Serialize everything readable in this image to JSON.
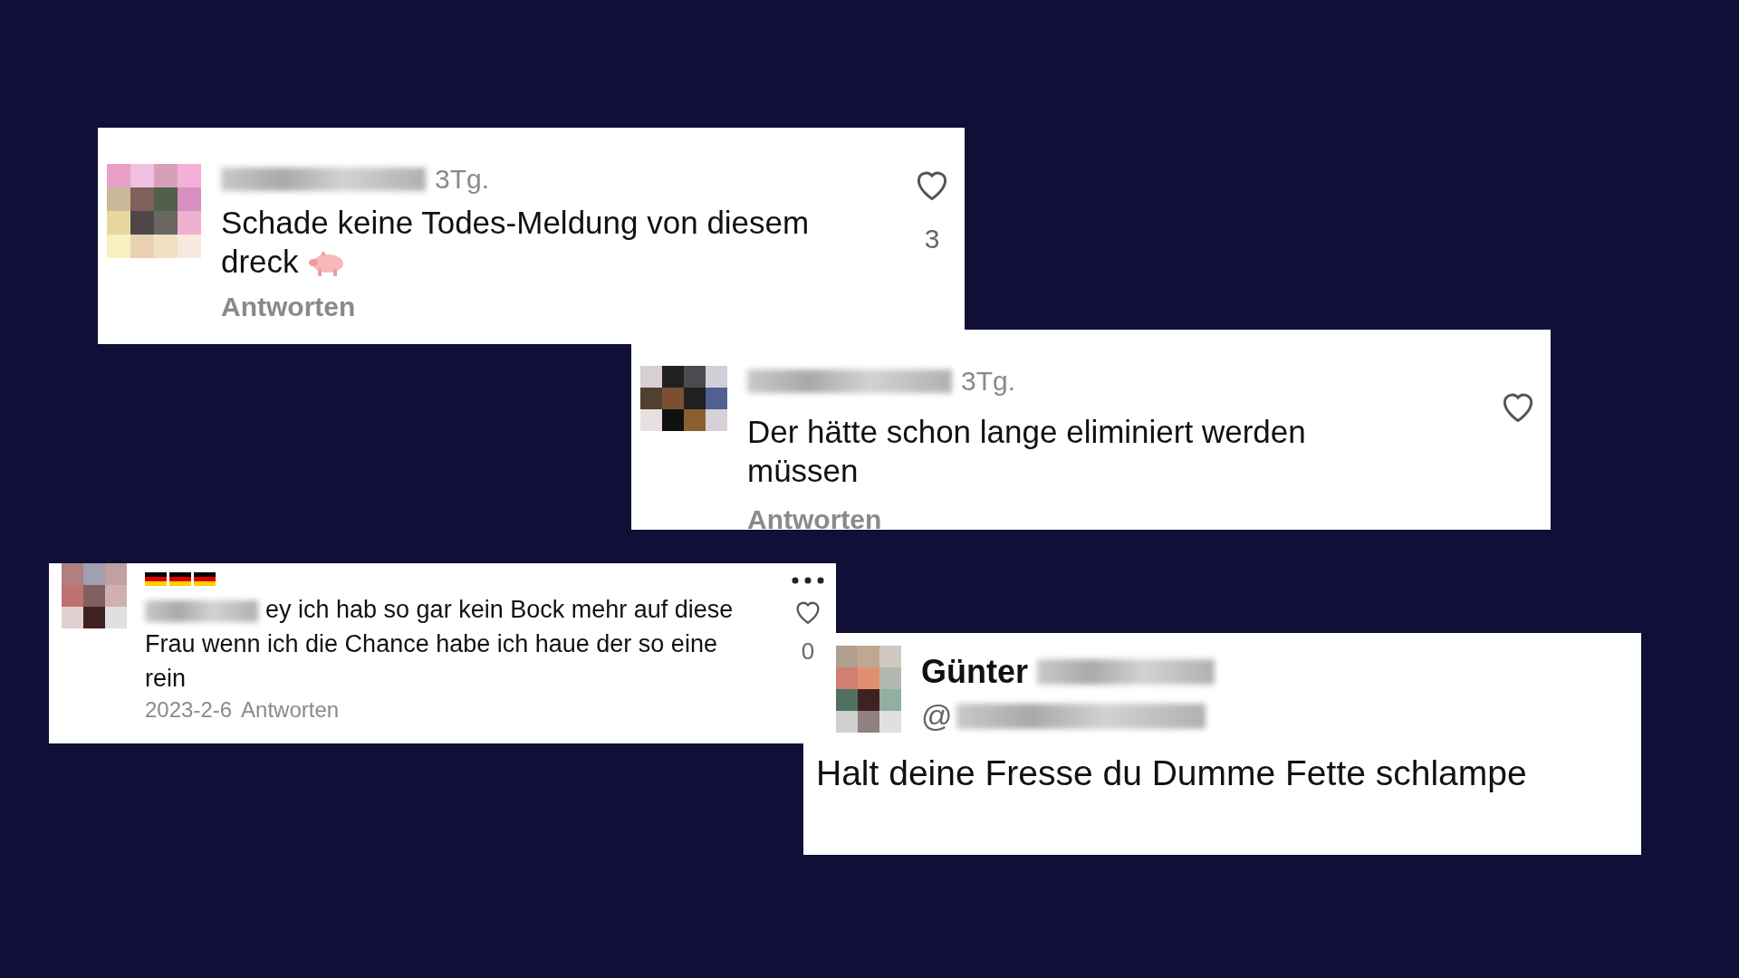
{
  "comments": [
    {
      "kind": "app",
      "time": "3Tg.",
      "text": "Schade keine Todes-Meldung von diesem dreck",
      "emoji": true,
      "likes": "3",
      "reply": "Antworten"
    },
    {
      "kind": "app",
      "time": "3Tg.",
      "text": "Der hätte schon lange eliminiert werden müssen",
      "emoji": false,
      "reply": "Antworten"
    },
    {
      "kind": "compact",
      "text": "ey ich hab so gar kein Bock mehr auf diese Frau wenn ich die Chance habe ich haue der so eine rein",
      "date": "2023-2-6",
      "reply": "Antworten",
      "likes": "0"
    },
    {
      "kind": "tweet",
      "name": "Günter",
      "handle": "@",
      "text": "Halt deine Fresse du Dumme Fette schlampe"
    }
  ]
}
